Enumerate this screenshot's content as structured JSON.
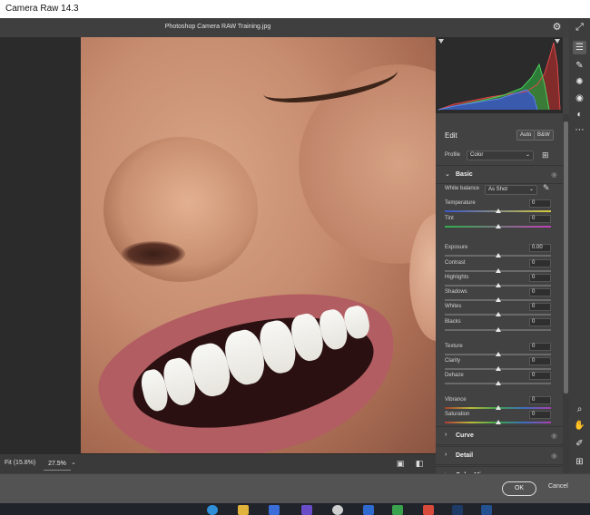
{
  "window": {
    "title": "Camera Raw 14.3"
  },
  "document": {
    "title": "Photoshop Camera RAW Training.jpg"
  },
  "header_icons": [
    "gear-icon",
    "expand-icon"
  ],
  "edit": {
    "title": "Edit",
    "auto_label": "Auto",
    "bw_label": "B&W"
  },
  "profile": {
    "label": "Profile",
    "value": "Color"
  },
  "basic": {
    "title": "Basic",
    "white_balance": {
      "label": "White balance",
      "value": "As Shot"
    },
    "sliders": [
      {
        "label": "Temperature",
        "value": "0",
        "level": 0.5,
        "track": "temp"
      },
      {
        "label": "Tint",
        "value": "0",
        "level": 0.5,
        "track": "tint"
      },
      {
        "label": "Exposure",
        "value": "0.00",
        "level": 0.5,
        "track": "plain"
      },
      {
        "label": "Contrast",
        "value": "0",
        "level": 0.5,
        "track": "plain"
      },
      {
        "label": "Highlights",
        "value": "0",
        "level": 0.5,
        "track": "plain"
      },
      {
        "label": "Shadows",
        "value": "0",
        "level": 0.5,
        "track": "plain"
      },
      {
        "label": "Whites",
        "value": "0",
        "level": 0.5,
        "track": "plain"
      },
      {
        "label": "Blacks",
        "value": "0",
        "level": 0.5,
        "track": "plain"
      },
      {
        "label": "Texture",
        "value": "0",
        "level": 0.5,
        "track": "plain"
      },
      {
        "label": "Clarity",
        "value": "0",
        "level": 0.5,
        "track": "plain"
      },
      {
        "label": "Dehaze",
        "value": "0",
        "level": 0.5,
        "track": "plain"
      },
      {
        "label": "Vibrance",
        "value": "0",
        "level": 0.5,
        "track": "vib"
      },
      {
        "label": "Saturation",
        "value": "0",
        "level": 0.5,
        "track": "sat"
      }
    ]
  },
  "sections": [
    {
      "name": "Curve"
    },
    {
      "name": "Detail"
    },
    {
      "name": "Color Mixer"
    }
  ],
  "footer": {
    "fit_label": "Fit (15.8%)",
    "zoom_value": "27.5%",
    "ok_label": "OK",
    "cancel_label": "Cancel"
  },
  "tools_top": [
    "sliders-icon",
    "brush-icon",
    "heal-icon",
    "redeye-icon",
    "masking-icon",
    "more-icon"
  ],
  "tools_bottom": [
    "zoom-icon",
    "hand-icon",
    "sampler-icon",
    "grid-icon"
  ]
}
